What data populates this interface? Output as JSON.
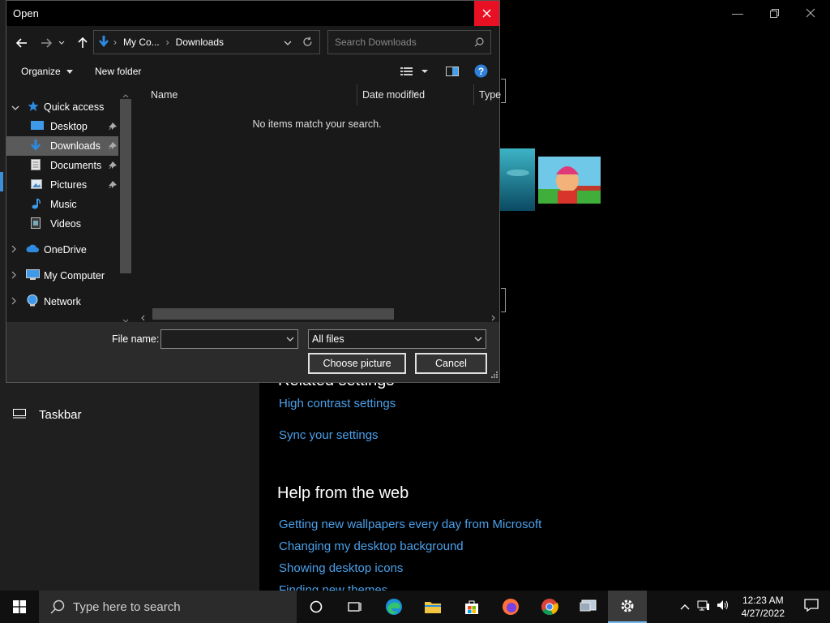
{
  "dialog": {
    "title": "Open",
    "breadcrumb": [
      "My Co...",
      "Downloads"
    ],
    "search_placeholder": "Search Downloads",
    "organize_label": "Organize",
    "new_folder_label": "New folder",
    "nav_items": {
      "quick_access": "Quick access",
      "desktop": "Desktop",
      "downloads": "Downloads",
      "documents": "Documents",
      "pictures": "Pictures",
      "music": "Music",
      "videos": "Videos",
      "onedrive": "OneDrive",
      "my_computer": "My Computer",
      "network": "Network"
    },
    "columns": {
      "name": "Name",
      "date_modified": "Date modified",
      "type": "Type"
    },
    "empty_message": "No items match your search.",
    "file_name_label": "File name:",
    "file_name_value": "",
    "file_type_value": "All files",
    "open_button": "Choose picture",
    "cancel_button": "Cancel"
  },
  "settings": {
    "nav_taskbar": "Taskbar",
    "related_heading": "Related settings",
    "related_links": [
      "High contrast settings",
      "Sync your settings"
    ],
    "help_heading": "Help from the web",
    "help_links": [
      "Getting new wallpapers every day from Microsoft",
      "Changing my desktop background",
      "Showing desktop icons",
      "Finding new themes"
    ]
  },
  "taskbar": {
    "search_placeholder": "Type here to search",
    "time": "12:23 AM",
    "date": "4/27/2022"
  },
  "colors": {
    "accent": "#3b8ed8",
    "link": "#4aa0ea",
    "close_red": "#e81123"
  }
}
